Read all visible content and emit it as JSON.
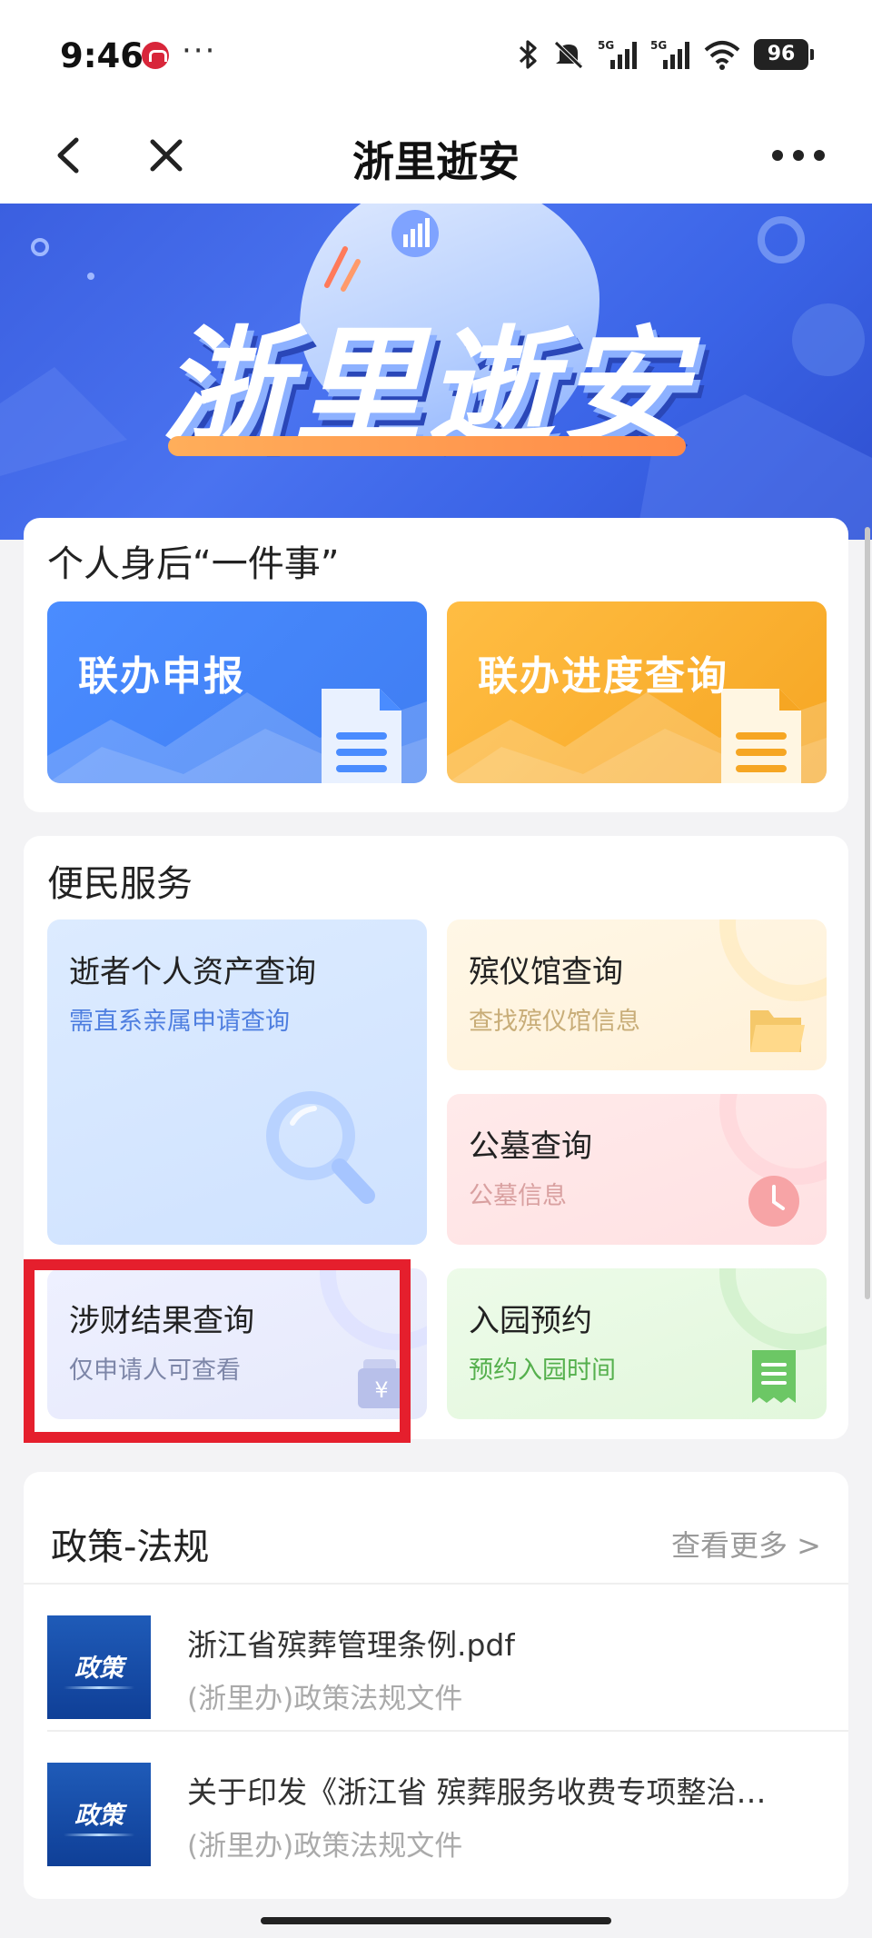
{
  "status_bar": {
    "time": "9:46",
    "more": "···",
    "battery": "96",
    "icons": [
      "bluetooth-icon",
      "mute-icon",
      "signal-5g-icon",
      "signal-5g-icon",
      "wifi-icon",
      "battery-icon"
    ]
  },
  "nav": {
    "title": "浙里逝安",
    "back_icon": "chevron-left-icon",
    "close_icon": "close-icon",
    "more_icon": "more-dots-icon"
  },
  "banner": {
    "title": "浙里逝安",
    "accent_color": "#ff8a48"
  },
  "section_personal": {
    "title": "个人身后“一件事”",
    "tiles": [
      {
        "label": "联办申报",
        "color": "#4a8cff"
      },
      {
        "label": "联办进度查询",
        "color": "#f6a623"
      }
    ]
  },
  "section_services": {
    "title": "便民服务",
    "items": [
      {
        "title": "逝者个人资产查询",
        "subtitle": "需直系亲属申请查询",
        "icon": "magnifier-icon"
      },
      {
        "title": "殡仪馆查询",
        "subtitle": "查找殡仪馆信息",
        "icon": "folder-icon"
      },
      {
        "title": "公墓查询",
        "subtitle": "公墓信息",
        "icon": "clock-icon"
      },
      {
        "title": "涉财结果查询",
        "subtitle": "仅申请人可查看",
        "icon": "wallet-icon"
      },
      {
        "title": "入园预约",
        "subtitle": "预约入园时间",
        "icon": "receipt-icon"
      }
    ],
    "highlight_color": "#e51f2d"
  },
  "section_policy": {
    "title": "政策-法规",
    "more": "查看更多 >",
    "items": [
      {
        "thumb": "政策",
        "name": "浙江省殡葬管理条例.pdf",
        "source": "(浙里办)政策法规文件"
      },
      {
        "thumb": "政策",
        "name": "关于印发《浙江省 殡葬服务收费专项整治…",
        "source": "(浙里办)政策法规文件"
      }
    ]
  }
}
